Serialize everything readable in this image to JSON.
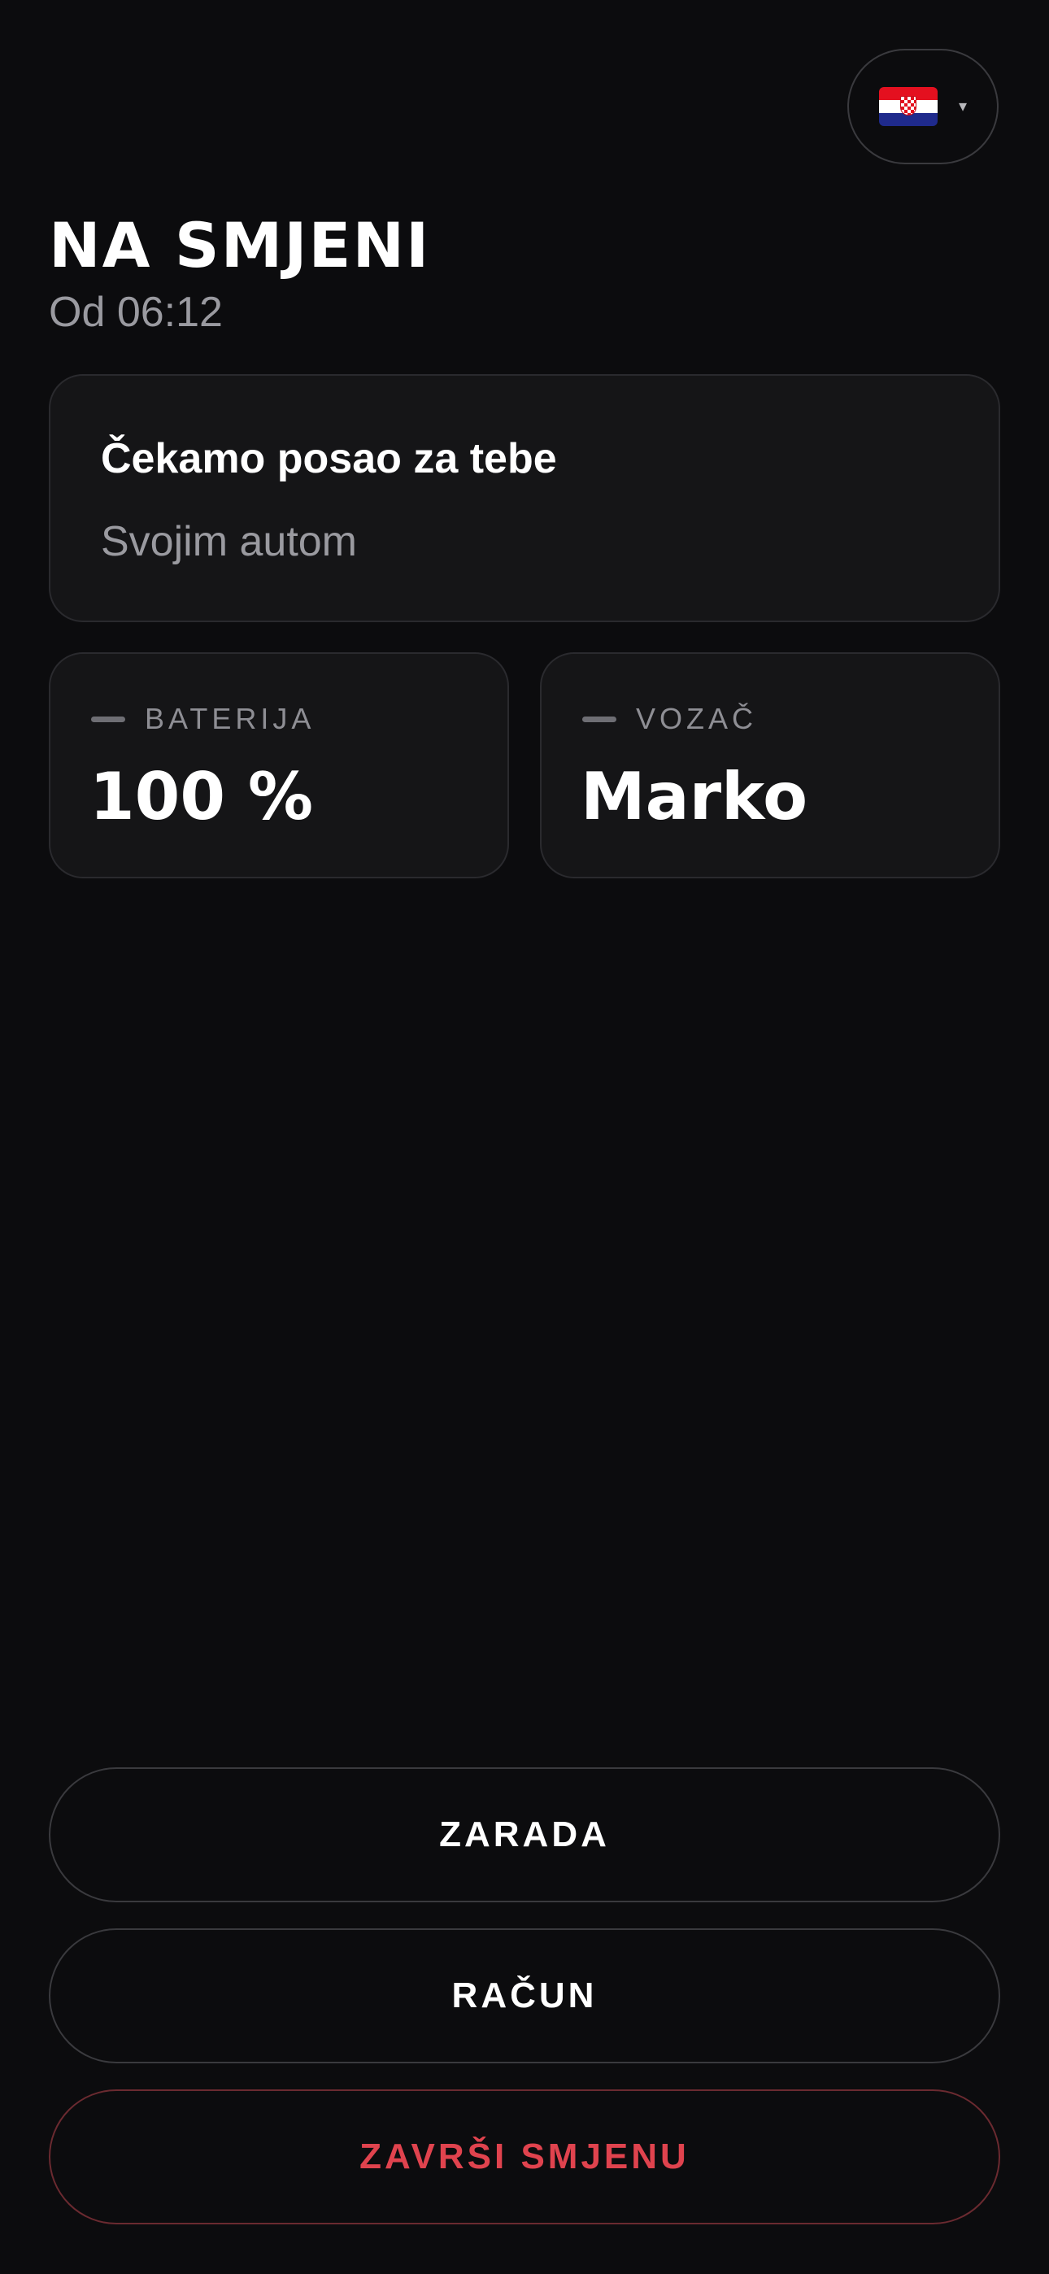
{
  "header": {
    "language": {
      "flag_icon": "croatia-flag-icon",
      "caret_icon": "caret-down-icon",
      "caret_glyph": "▾"
    },
    "title": "NA SMJENI",
    "since": "Od 06:12"
  },
  "status_card": {
    "title": "Čekamo posao za tebe",
    "subtitle": "Svojim autom"
  },
  "stats": {
    "battery": {
      "label": "BATERIJA",
      "value": "100 %"
    },
    "driver": {
      "label": "VOZAČ",
      "value": "Marko"
    }
  },
  "actions": {
    "earnings_label": "ZARADA",
    "invoice_label": "RAČUN",
    "end_shift_label": "ZAVRŠI SMJENU"
  },
  "colors": {
    "background": "#0c0c0e",
    "card": "#151517",
    "danger": "#e0434e"
  }
}
